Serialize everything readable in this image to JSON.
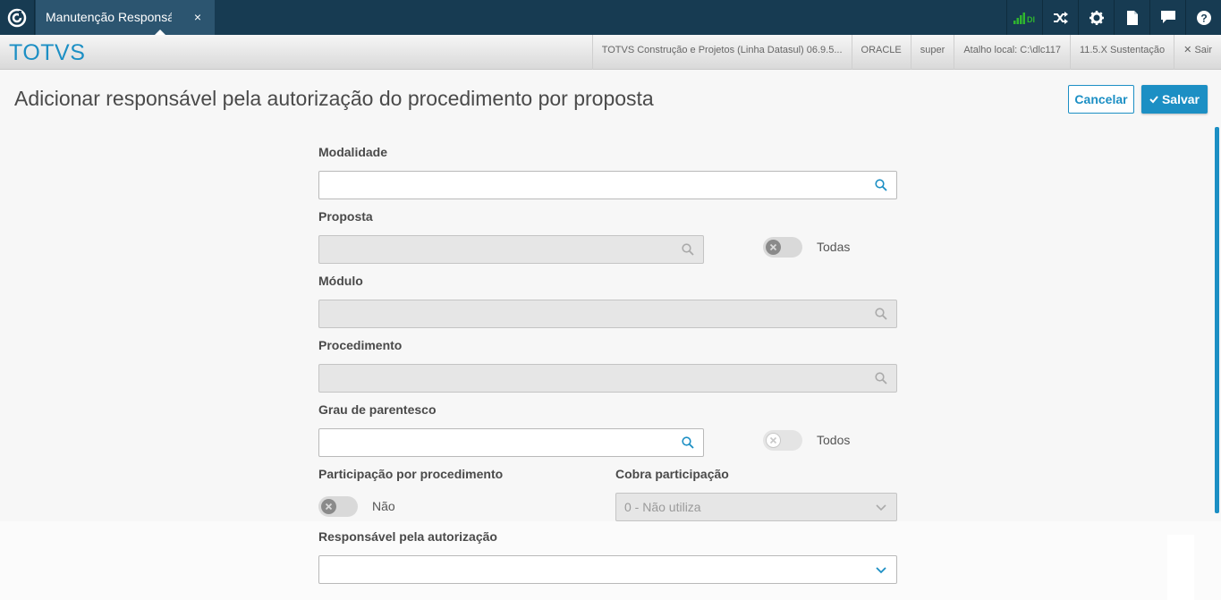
{
  "topbar": {
    "tab_label": "Manutenção Responsável",
    "tab_close": "×",
    "icons": [
      "di-signal-icon",
      "shuffle-icon",
      "gear-icon",
      "document-icon",
      "chat-icon",
      "help-icon"
    ],
    "di_badge": "DI"
  },
  "header": {
    "brand": "TOTVS",
    "info": [
      "TOTVS Construção e Projetos (Linha Datasul) 06.9.5...",
      "ORACLE",
      "super",
      "Atalho local: C:\\dlc117",
      "11.5.X Sustentação"
    ],
    "sair": "Sair"
  },
  "page": {
    "title": "Adicionar responsável pela autorização do procedimento por proposta",
    "cancel": "Cancelar",
    "save": "Salvar"
  },
  "form": {
    "modalidade_label": "Modalidade",
    "proposta_label": "Proposta",
    "todas_label": "Todas",
    "modulo_label": "Módulo",
    "procedimento_label": "Procedimento",
    "grau_label": "Grau de parentesco",
    "todos_label": "Todos",
    "participacao_label": "Participação por procedimento",
    "nao_label": "Não",
    "cobra_label": "Cobra participação",
    "cobra_value": "0 - Não utiliza",
    "responsavel_label": "Responsável pela autorização"
  },
  "colors": {
    "topbar": "#173b52",
    "accent": "#1c8fc4",
    "signal": "#2fb52f"
  }
}
